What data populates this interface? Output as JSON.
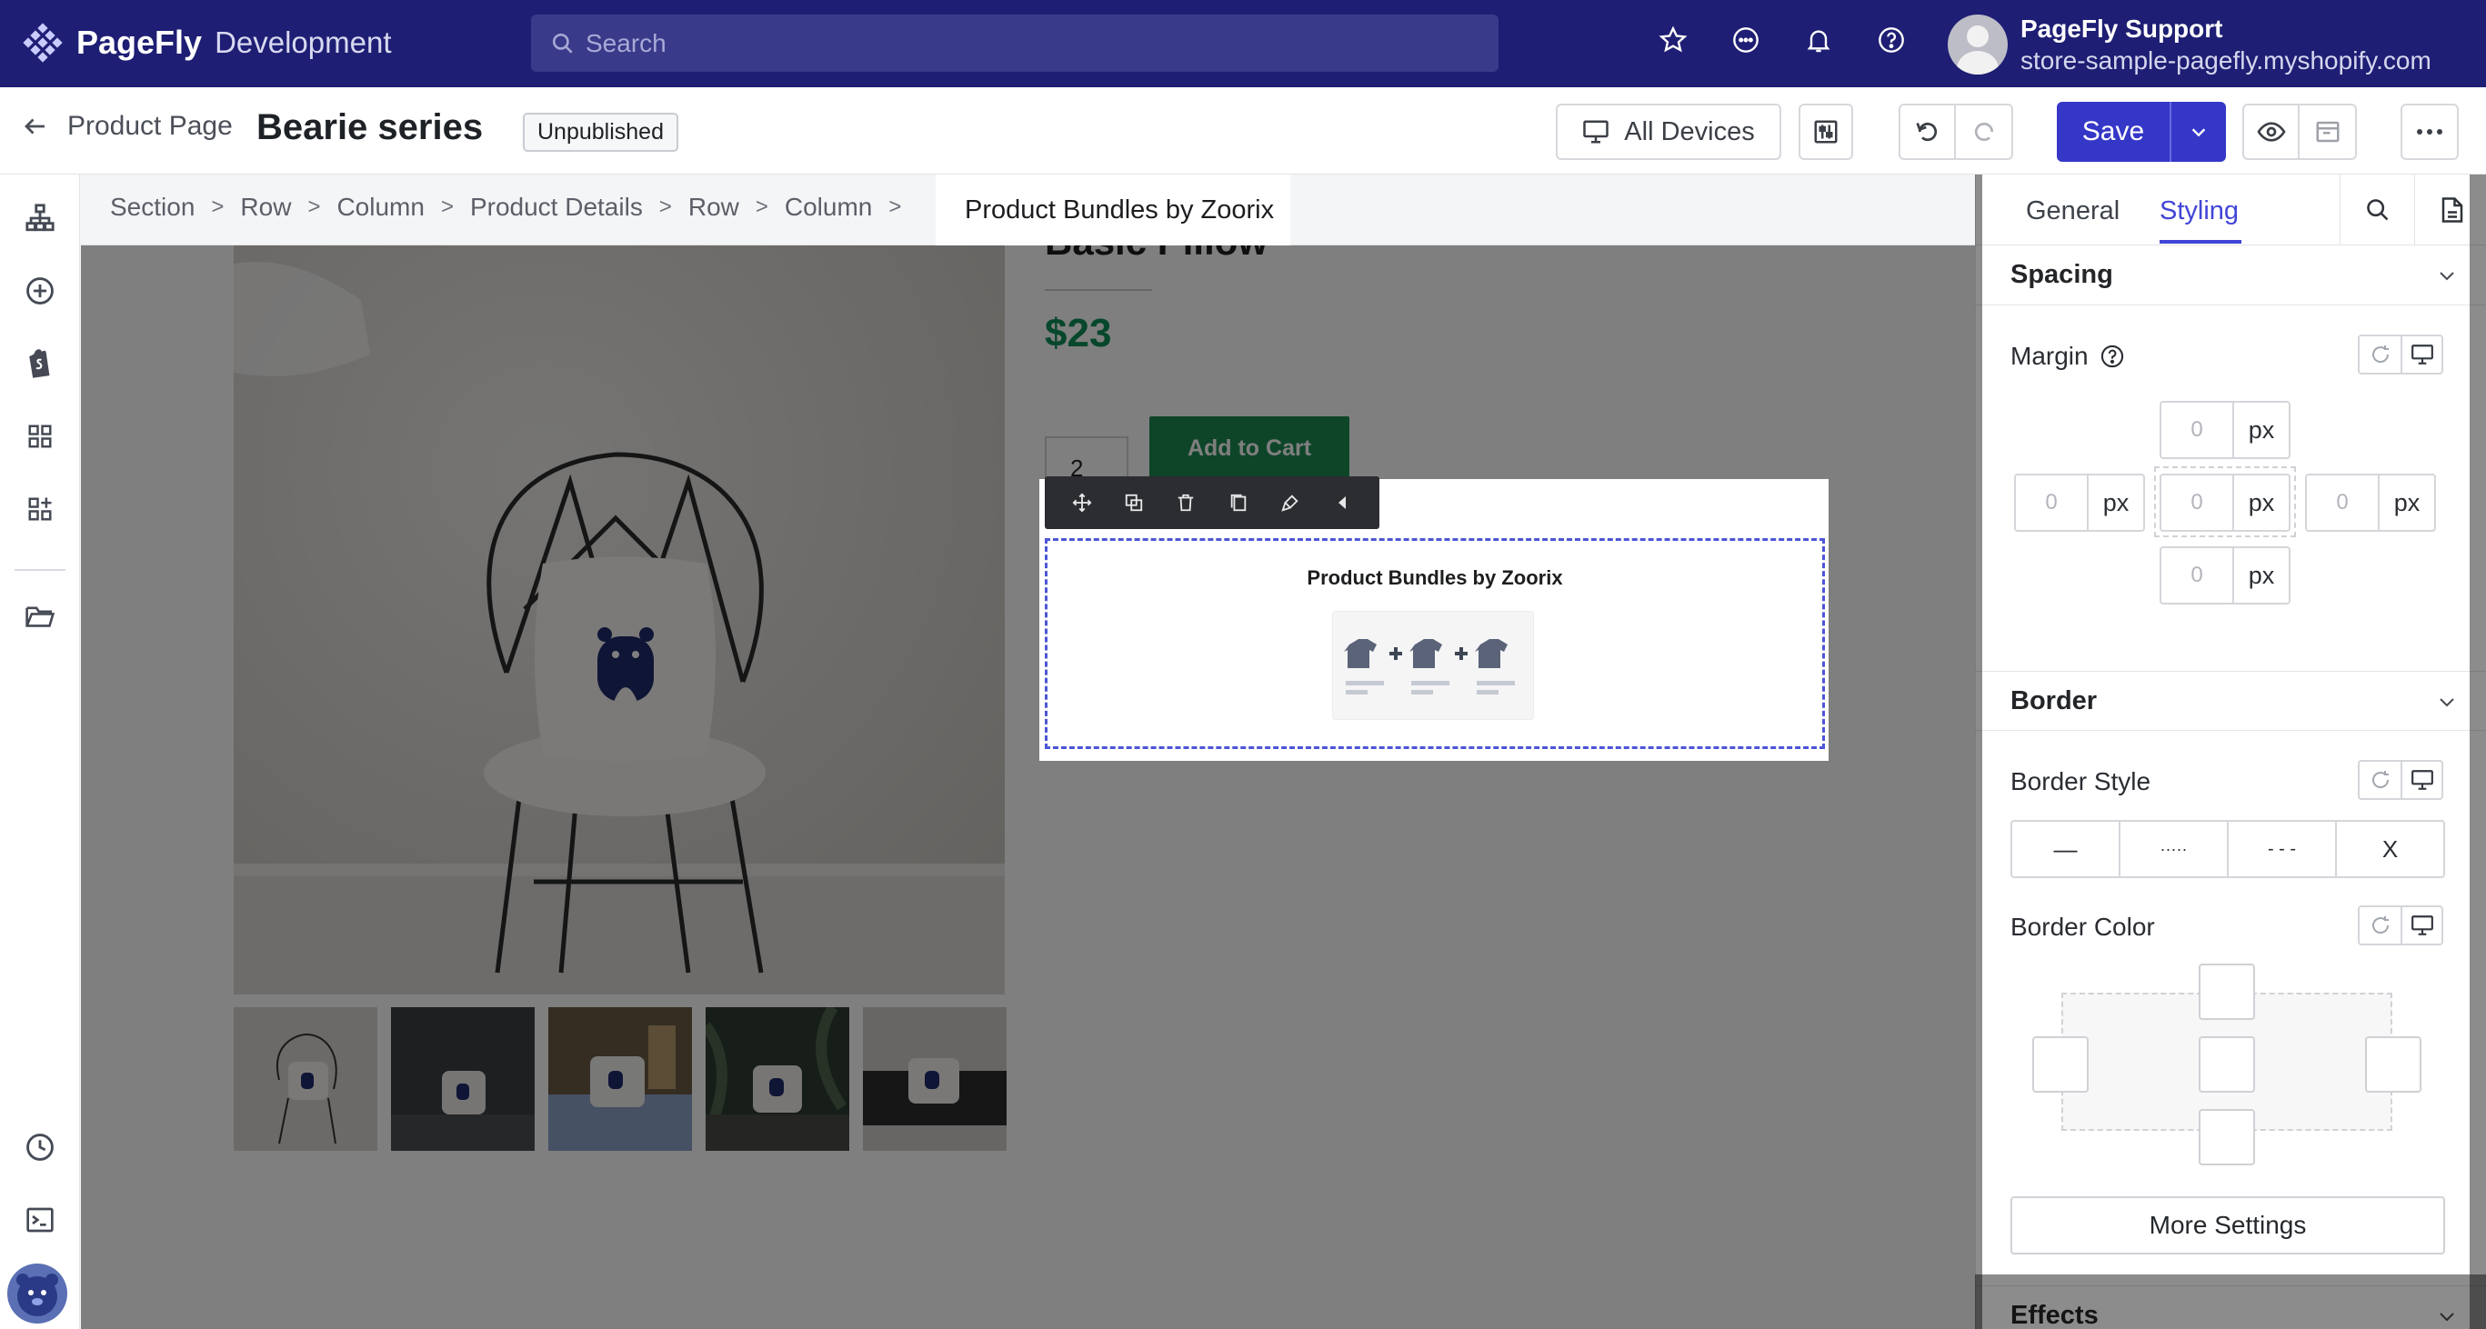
{
  "brand": {
    "name": "PageFly",
    "suffix": "Development"
  },
  "search": {
    "placeholder": "Search"
  },
  "user": {
    "name": "PageFly Support",
    "store": "store-sample-pagefly.myshopify.com"
  },
  "header": {
    "back_label": "Product Page",
    "title": "Bearie series",
    "status": "Unpublished",
    "devices_label": "All Devices",
    "save_label": "Save"
  },
  "breadcrumb": {
    "items": [
      "Section",
      "Row",
      "Column",
      "Product Details",
      "Row",
      "Column"
    ],
    "active": "Product Bundles by Zoorix"
  },
  "product": {
    "title": "Basic Pillow",
    "price": "$23",
    "quantity": "2",
    "add_to_cart": "Add to Cart"
  },
  "selected_element": {
    "title": "Product Bundles by Zoorix"
  },
  "panel": {
    "tabs": [
      "General",
      "Styling"
    ],
    "active_tab": "Styling",
    "spacing": {
      "heading": "Spacing",
      "margin_label": "Margin",
      "top": {
        "value": "0",
        "unit": "px"
      },
      "left": {
        "value": "0",
        "unit": "px"
      },
      "center": {
        "value": "0",
        "unit": "px"
      },
      "right": {
        "value": "0",
        "unit": "px"
      },
      "bottom": {
        "value": "0",
        "unit": "px"
      }
    },
    "border": {
      "heading": "Border",
      "style_label": "Border Style",
      "styles": [
        "—",
        "·····",
        "- - -",
        "X"
      ],
      "color_label": "Border Color",
      "more_settings": "More Settings"
    },
    "effects": {
      "heading": "Effects"
    }
  },
  "colors": {
    "topbar": "#1e1e74",
    "accent": "#3537c7",
    "price": "#0e8f58",
    "add_to_cart": "#1c8a52",
    "selection": "#4d55d6"
  }
}
